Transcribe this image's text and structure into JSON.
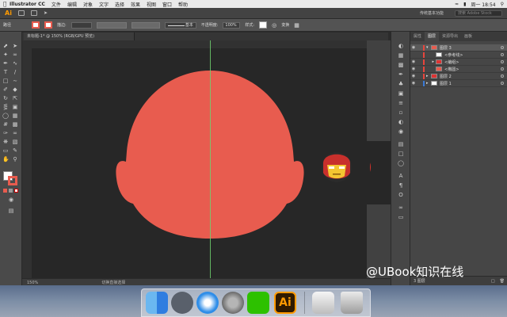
{
  "menubar": {
    "app_name": "Illustrator CC",
    "items": [
      "文件",
      "编辑",
      "对象",
      "文字",
      "选择",
      "效果",
      "视图",
      "窗口",
      "帮助"
    ],
    "clock": "周一 18:54"
  },
  "app_bar": {
    "logo": "Ai",
    "workspace": "传统基本功能",
    "search_placeholder": "搜索 Adobe Stock"
  },
  "control_bar": {
    "path_label": "路径",
    "stroke_label": "描边:",
    "stroke_style": "基本",
    "opacity_label": "不透明度:",
    "opacity_value": "100%",
    "style_label": "样式:",
    "transform_label": "变换"
  },
  "document": {
    "tab_title": "未标题-1* @ 150% (RGB/GPU 预览)",
    "zoom": "150%",
    "status": "切换直接选择"
  },
  "layers_panel": {
    "tabs": [
      "属性",
      "图层",
      "资源导出",
      "画板"
    ],
    "active_tab": "图层",
    "layers": [
      {
        "name": "图层 3",
        "color": "#e8453c",
        "selected": true
      },
      {
        "name": "<参考线>",
        "color": "#e8453c",
        "selected": false
      },
      {
        "name": "<编组>",
        "color": "#e8453c",
        "selected": false
      },
      {
        "name": "<椭圆>",
        "color": "#e8453c",
        "selected": false
      },
      {
        "name": "图层 2",
        "color": "#e8453c",
        "selected": false
      },
      {
        "name": "图层 1",
        "color": "#3a7ad6",
        "selected": false
      }
    ],
    "footer": "3 图层"
  },
  "canvas": {
    "head_color": "#e85c4f",
    "guide_color": "#6fd06f"
  },
  "watermark": "@UBook知识在线",
  "dock": {
    "apps": [
      "Finder",
      "Launchpad",
      "Safari",
      "System Preferences",
      "WeChat",
      "Adobe Illustrator",
      "Preview",
      "Trash"
    ],
    "ai_label": "Ai"
  }
}
